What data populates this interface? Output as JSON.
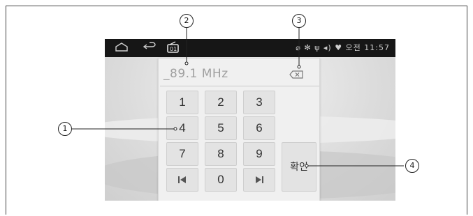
{
  "status_bar": {
    "home_icon": "home-icon",
    "back_icon": "back-icon",
    "radio_icon": "radio-icon",
    "right_text": "⌀ ✻ ψ ◂) ♥ 오전 11:57"
  },
  "dialog": {
    "frequency_value": "_89.1 MHz",
    "backspace_icon": "backspace-icon",
    "keys": {
      "k1": "1",
      "k2": "2",
      "k3": "3",
      "k4": "4",
      "k5": "5",
      "k6": "6",
      "k7": "7",
      "k8": "8",
      "k9": "9",
      "k0": "0",
      "prev_icon": "skip-previous-icon",
      "next_icon": "skip-next-icon",
      "confirm": "확인"
    }
  },
  "callouts": {
    "c1": "1",
    "c2": "2",
    "c3": "3",
    "c4": "4"
  },
  "colors": {
    "status_bar_bg": "#161616",
    "dialog_bg": "#f0f0f0",
    "key_bg": "#e3e3e3",
    "frequency_text": "#a0a0a0"
  }
}
